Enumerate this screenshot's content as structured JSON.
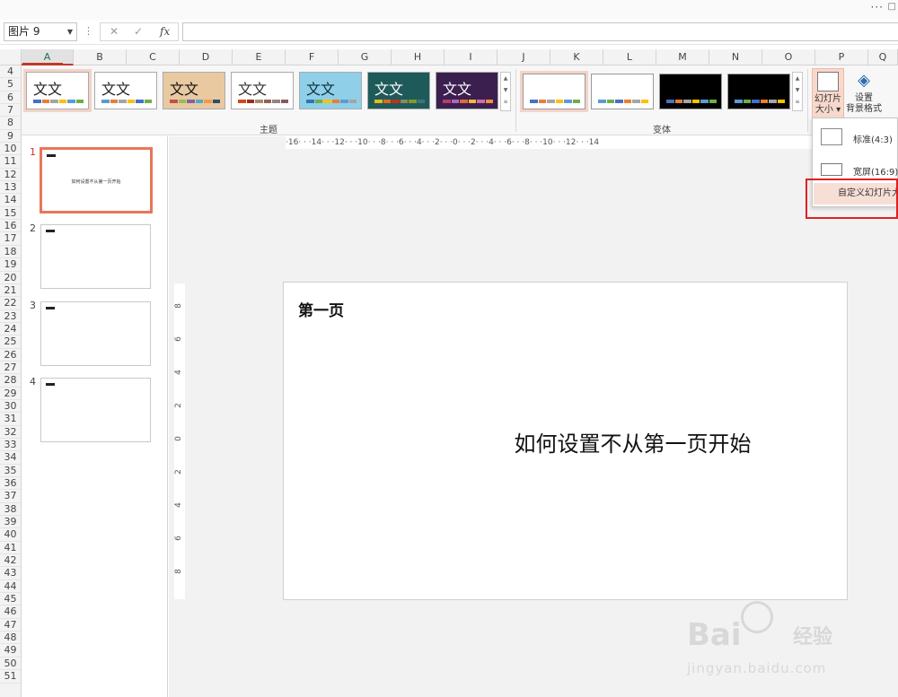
{
  "topbar": {
    "more": "···",
    "edge": "□"
  },
  "formula_bar": {
    "name_box": "图片 9",
    "dropdown": "▼",
    "dots": "⋮",
    "cancel": "✕",
    "confirm": "✓",
    "fx": "fx",
    "value": ""
  },
  "columns": [
    "A",
    "B",
    "C",
    "D",
    "E",
    "F",
    "G",
    "H",
    "I",
    "J",
    "K",
    "L",
    "M",
    "N",
    "O",
    "P",
    "Q"
  ],
  "rows": [
    "4",
    "5",
    "6",
    "7",
    "8",
    "9",
    "10",
    "11",
    "12",
    "13",
    "14",
    "15",
    "16",
    "17",
    "18",
    "19",
    "20",
    "21",
    "22",
    "23",
    "24",
    "25",
    "26",
    "27",
    "28",
    "29",
    "30",
    "31",
    "32",
    "33",
    "34",
    "35",
    "36",
    "37",
    "38",
    "39",
    "40",
    "41",
    "42",
    "43",
    "44",
    "45",
    "46",
    "47",
    "48",
    "49",
    "50",
    "51"
  ],
  "ribbon": {
    "themes_label": "主题",
    "variants_label": "变体",
    "theme_text": "文文",
    "themes": [
      {
        "bg": "#ffffff",
        "fg": "#222222",
        "swatches": [
          "#4472c4",
          "#ed7d31",
          "#a5a5a5",
          "#ffc000",
          "#5b9bd5",
          "#70ad47"
        ]
      },
      {
        "bg": "#ffffff",
        "fg": "#222222",
        "swatches": [
          "#5b9bd5",
          "#ed7d31",
          "#a5a5a5",
          "#ffc000",
          "#4472c4",
          "#70ad47"
        ]
      },
      {
        "bg": "#e8c9a0",
        "fg": "#111111",
        "swatches": [
          "#c0504d",
          "#9bbb59",
          "#8064a2",
          "#4bacc6",
          "#f79646",
          "#2c4d75"
        ]
      },
      {
        "bg": "#ffffff",
        "fg": "#333333",
        "swatches": [
          "#d34817",
          "#9b2d1f",
          "#a28e6a",
          "#956251",
          "#918485",
          "#855d5d"
        ]
      },
      {
        "bg": "#8fd0e8",
        "fg": "#0b2e3d",
        "swatches": [
          "#2e75b6",
          "#70ad47",
          "#ffc000",
          "#ed7d31",
          "#5b9bd5",
          "#a5a5a5"
        ]
      },
      {
        "bg": "#1f5a5a",
        "fg": "#ffffff",
        "swatches": [
          "#e6b91e",
          "#e76618",
          "#c42f1a",
          "#918655",
          "#83992a",
          "#3c7381"
        ]
      },
      {
        "bg": "#3b1f4f",
        "fg": "#ffffff",
        "swatches": [
          "#b83d68",
          "#ac66bb",
          "#de6c36",
          "#f9b639",
          "#cf6da4",
          "#fa8d3d"
        ]
      }
    ],
    "variants": [
      {
        "bg": "#ffffff",
        "swatches": [
          "#4472c4",
          "#ed7d31",
          "#a5a5a5",
          "#ffc000",
          "#5b9bd5",
          "#70ad47"
        ]
      },
      {
        "bg": "#ffffff",
        "swatches": [
          "#5b9bd5",
          "#70ad47",
          "#4472c4",
          "#ed7d31",
          "#a5a5a5",
          "#ffc000"
        ]
      },
      {
        "bg": "#000000",
        "swatches": [
          "#4472c4",
          "#ed7d31",
          "#a5a5a5",
          "#ffc000",
          "#5b9bd5",
          "#70ad47"
        ]
      },
      {
        "bg": "#000000",
        "swatches": [
          "#5b9bd5",
          "#70ad47",
          "#4472c4",
          "#ed7d31",
          "#a5a5a5",
          "#ffc000"
        ]
      }
    ],
    "slide_size_label_1": "幻灯片",
    "slide_size_label_2": "大小 ▾",
    "format_bg_label_1": "设置",
    "format_bg_label_2": "背景格式"
  },
  "dropdown": {
    "standard": "标准(4:3)",
    "widescreen": "宽屏(16:9)",
    "custom": "自定义幻灯片大小"
  },
  "slides_pane": [
    {
      "num": "1",
      "text": "如何设置不从第一页开始"
    },
    {
      "num": "2",
      "text": ""
    },
    {
      "num": "3",
      "text": ""
    },
    {
      "num": "4",
      "text": ""
    }
  ],
  "ruler": {
    "horizontal": "·16· · ·14· · ·12· · ·10· · ·8· · ·6· · ·4· · ·2· · ·0· · ·2· · ·4· · ·6· · ·8· · ·10· · ·12· · ·14",
    "vertical": [
      "8",
      "6",
      "4",
      "2",
      "0",
      "2",
      "4",
      "6",
      "8"
    ]
  },
  "slide": {
    "title": "第一页",
    "body": "如何设置不从第一页开始"
  },
  "watermark": {
    "brand": "Bai",
    "suffix": "经验",
    "url": "jingyan.baidu.com"
  }
}
